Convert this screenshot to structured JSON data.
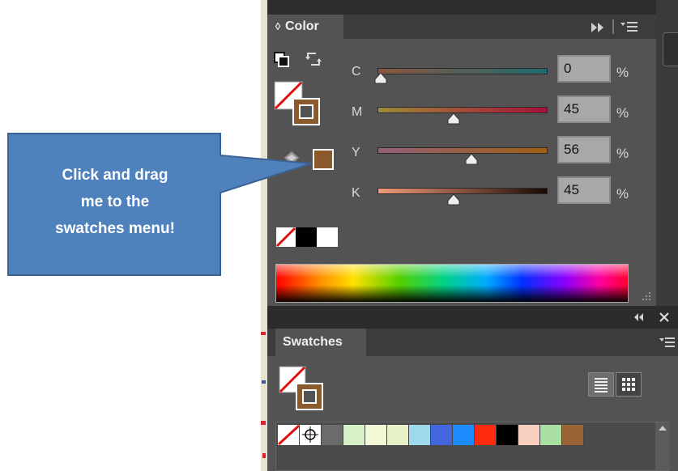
{
  "callout": {
    "text": "Click and drag\nme to  the\nswatches menu!"
  },
  "color_panel": {
    "tab_label": "Color",
    "tab_chevron": "◊",
    "menu_icons": [
      "fast-forward-icon",
      "menu-icon"
    ],
    "sliders": [
      {
        "label": "C",
        "value": "0",
        "unit": "%",
        "level": 0.0,
        "gradient": [
          "#8a5540",
          "#1f6a6e"
        ]
      },
      {
        "label": "M",
        "value": "45",
        "unit": "%",
        "level": 0.45,
        "gradient": [
          "#9a8a3a",
          "#a8103a"
        ]
      },
      {
        "label": "Y",
        "value": "56",
        "unit": "%",
        "level": 0.56,
        "gradient": [
          "#94607a",
          "#a06010"
        ]
      },
      {
        "label": "K",
        "value": "45",
        "unit": "%",
        "level": 0.45,
        "gradient": [
          "#f09a7a",
          "#1a0a05"
        ]
      }
    ],
    "current_color": "#8b5a2b",
    "stroke_color": "#8b5a2b",
    "quick_swatches": [
      "none",
      "#000000",
      "#ffffff"
    ]
  },
  "swatches_panel": {
    "tab_label": "Swatches",
    "header_icons": [
      "collapse-icon",
      "close-icon"
    ],
    "view_buttons": [
      "list-view-icon",
      "grid-view-icon"
    ],
    "swatches": [
      "none",
      "registration",
      "#6b6b6b",
      "#d6f0c8",
      "#f2f7d8",
      "#e6f2c6",
      "#9fd9ee",
      "#4466dd",
      "#1d8cff",
      "#ff2a10",
      "#000000",
      "#f9cfbf",
      "#a9dfa0",
      "#9a6434"
    ]
  }
}
